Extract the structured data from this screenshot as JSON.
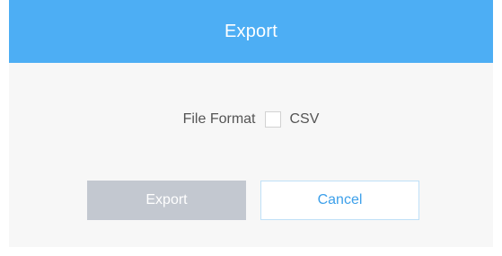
{
  "dialog": {
    "title": "Export",
    "header_color": "#4daef4"
  },
  "format": {
    "label": "File Format",
    "option_label": "CSV",
    "checked": false
  },
  "buttons": {
    "export_label": "Export",
    "export_enabled": false,
    "cancel_label": "Cancel"
  }
}
